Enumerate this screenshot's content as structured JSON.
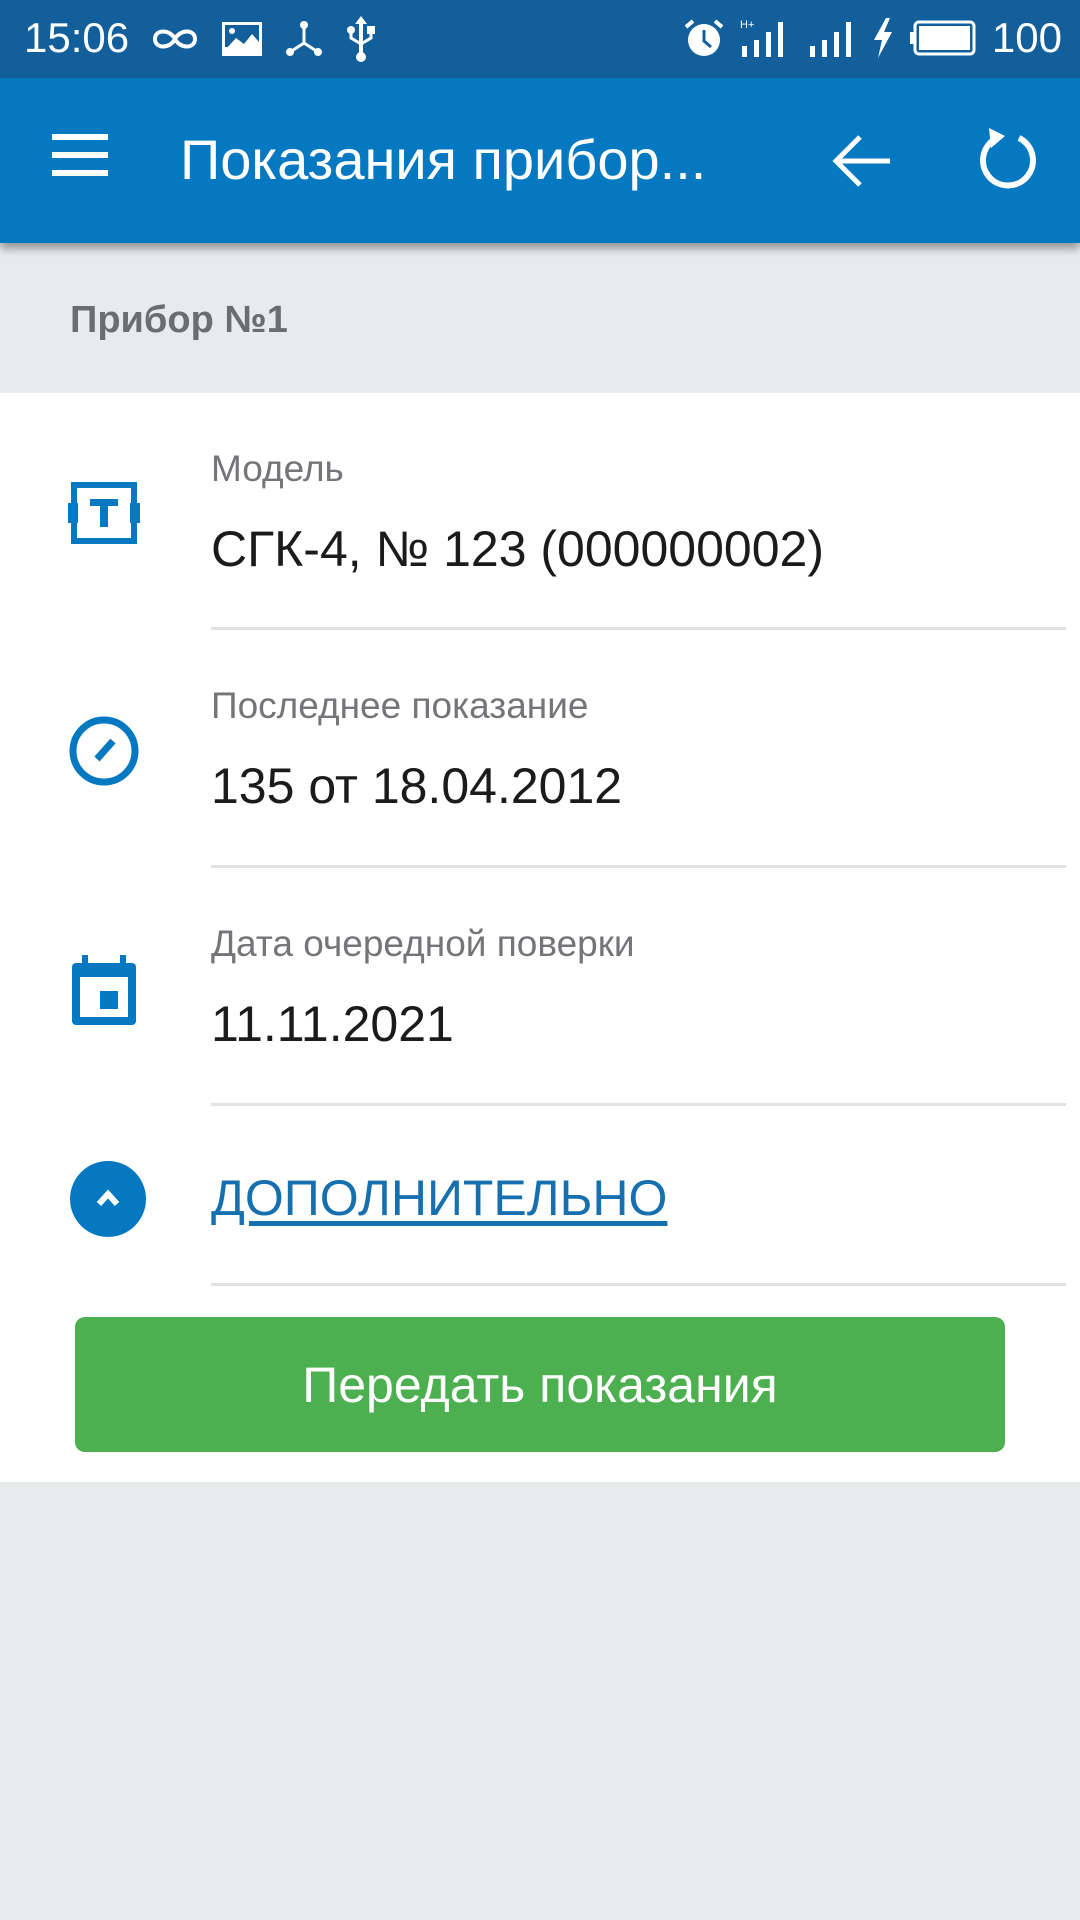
{
  "status_bar": {
    "time": "15:06",
    "left_icons": [
      "infinity-icon",
      "image-icon",
      "share-network-icon",
      "usb-icon"
    ],
    "right_icons": [
      "alarm-icon",
      "signal-h-plus-icon",
      "signal-icon",
      "charging-icon",
      "battery-icon"
    ],
    "network_type": "H+",
    "battery_level": "100"
  },
  "app_bar": {
    "title": "Показания прибор...",
    "menu_icon": "menu-icon",
    "back_icon": "arrow-back-icon",
    "refresh_icon": "refresh-icon"
  },
  "device": {
    "title": "Прибор №1",
    "fields": [
      {
        "label": "Модель",
        "value": "СГК-4, № 123 (000000002)",
        "icon": "meter-model-icon"
      },
      {
        "label": "Последнее показание",
        "value": "135 от 18.04.2012",
        "icon": "gauge-icon"
      },
      {
        "label": "Дата очередной поверки",
        "value": "11.11.2021",
        "icon": "calendar-icon"
      }
    ],
    "more_label": "ДОПОЛНИТЕЛЬНО",
    "submit_label": "Передать показания"
  },
  "colors": {
    "status_bar": "#125f9c",
    "app_bar": "#0478c1",
    "accent": "#0478c1",
    "button": "#4caf50",
    "background": "#e8ebec"
  }
}
